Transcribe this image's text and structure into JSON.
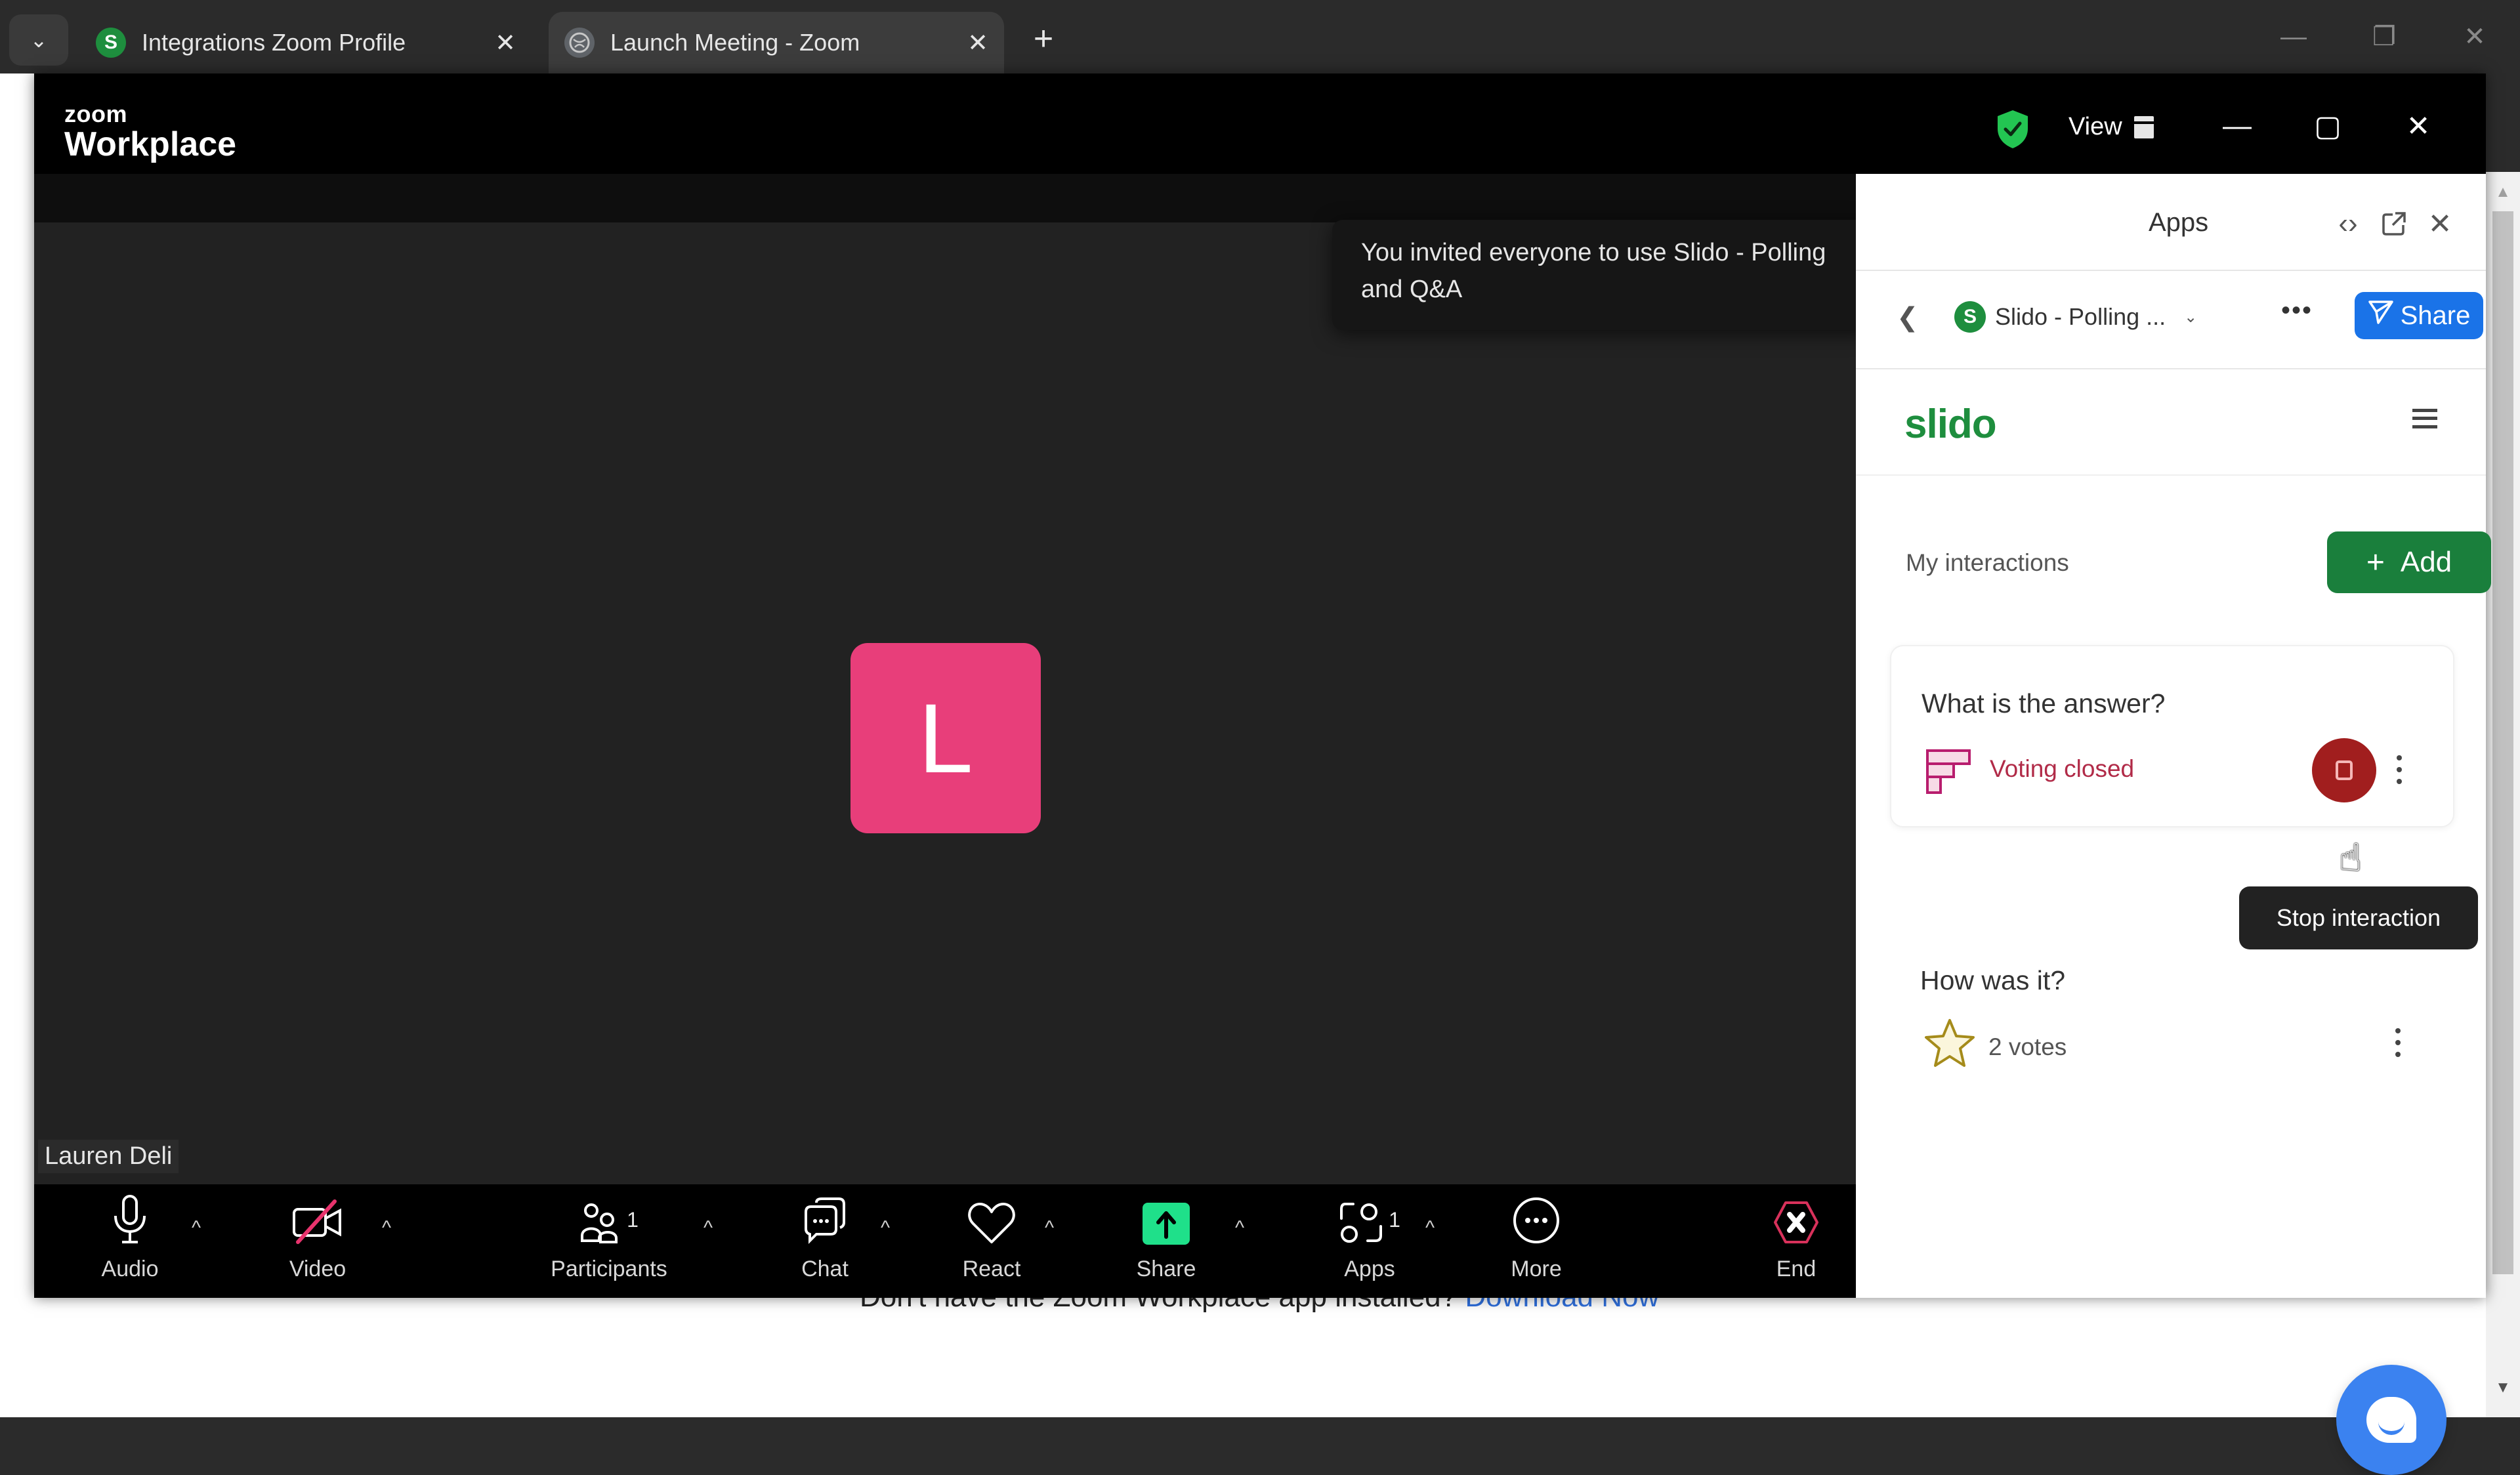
{
  "browser": {
    "tabs": [
      {
        "title": "Integrations Zoom Profile",
        "favicon": "S",
        "active": false
      },
      {
        "title": "Launch Meeting - Zoom",
        "favicon": "globe",
        "active": true
      }
    ],
    "tab_list_icon": "chevron-down",
    "new_tab_icon": "+",
    "close_icon": "✕",
    "window_controls": {
      "minimize": "—",
      "restore": "❐",
      "close": "✕"
    },
    "page": {
      "download_text": "Don't have the Zoom Workplace app installed?",
      "download_link": "Download Now"
    }
  },
  "zoom": {
    "logo_small": "zoom",
    "logo_big": "Workplace",
    "view_label": "View",
    "window_controls": {
      "minimize": "—",
      "maximize": "▢",
      "close": "✕"
    },
    "toast": "You invited everyone to use Slido - Polling and Q&A",
    "participant": {
      "initial": "L",
      "name": "Lauren Deli",
      "avatar_color": "#e83e7a"
    },
    "toolbar": {
      "audio": "Audio",
      "video": "Video",
      "participants": "Participants",
      "participants_count": "1",
      "chat": "Chat",
      "react": "React",
      "share": "Share",
      "apps": "Apps",
      "apps_count": "1",
      "more": "More",
      "end": "End",
      "caret": "^"
    },
    "colors": {
      "share_green": "#1fe08a",
      "end_red": "#d8315b",
      "video_off_slash": "#e8336d"
    }
  },
  "apps_panel": {
    "title": "Apps",
    "app_name": "Slido - Polling ...",
    "app_favicon": "S",
    "share_label": "Share",
    "more_icon": "•••",
    "slido": {
      "logo": "slido",
      "section_label": "My interactions",
      "add_label": "Add",
      "interactions": [
        {
          "question": "What is the answer?",
          "type": "poll",
          "status": "Voting closed"
        },
        {
          "question": "How was it?",
          "type": "rating",
          "status": "2 votes"
        }
      ],
      "tooltip": "Stop interaction"
    },
    "colors": {
      "slido_green": "#1e8e3e",
      "add_green": "#1a7f3c",
      "share_blue": "#1a73e8",
      "stop_red": "#a11e1e",
      "status_red": "#b12b48"
    }
  }
}
